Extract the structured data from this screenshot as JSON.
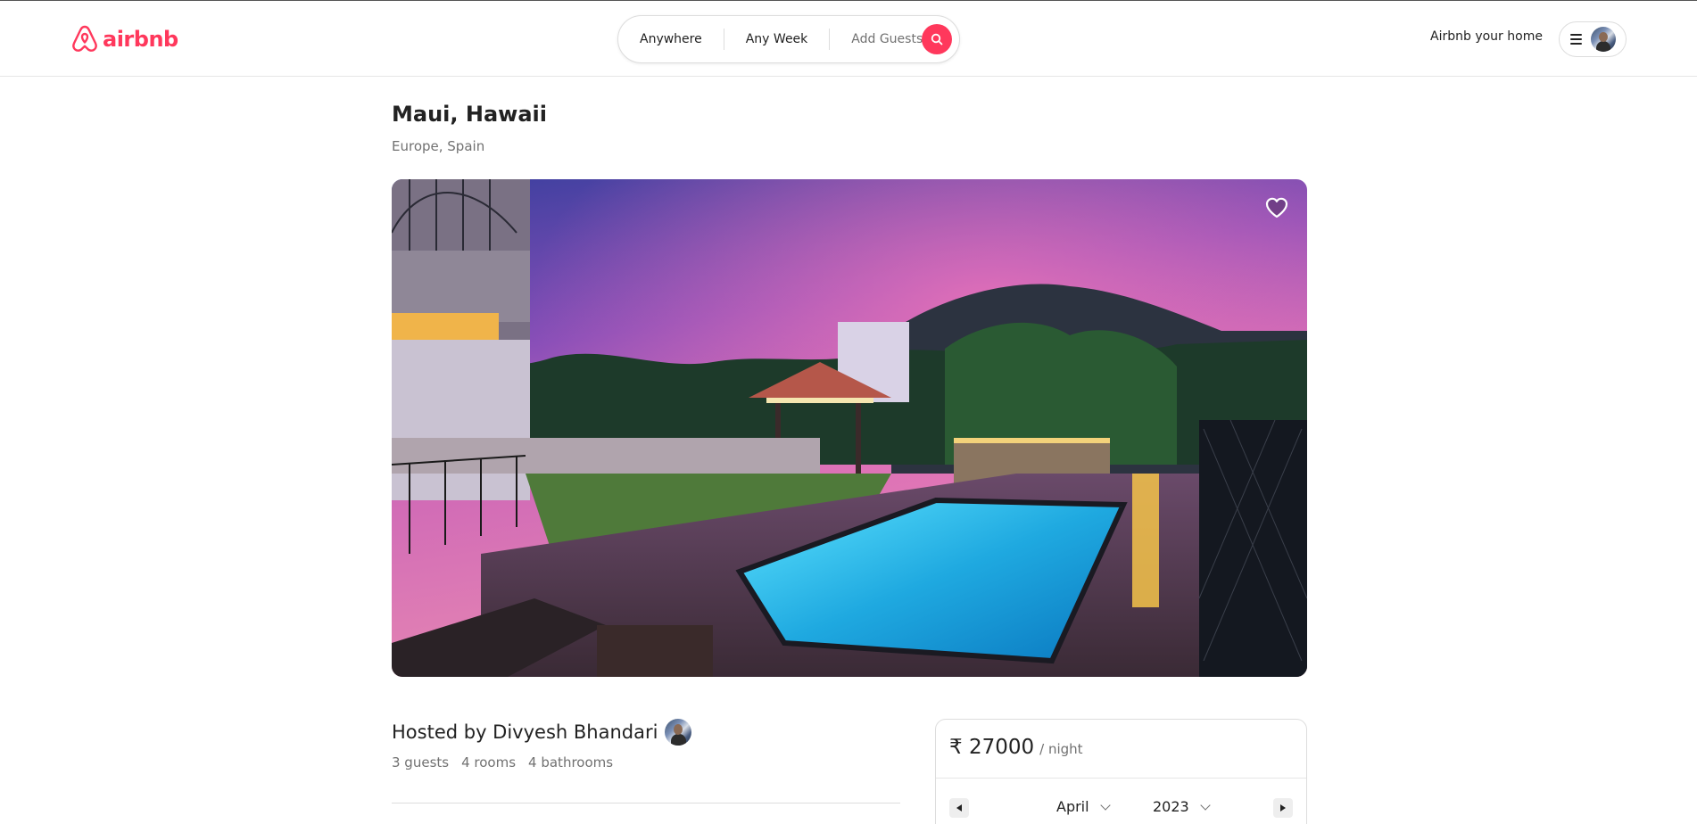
{
  "header": {
    "brand": "airbnb",
    "brand_color": "#FF385C",
    "search": {
      "where": "Anywhere",
      "when": "Any Week",
      "guests": "Add Guests"
    },
    "host_link": "Airbnb your home",
    "icons": {
      "logo": "airbnb-logo-icon",
      "search": "search-icon",
      "menu": "hamburger-menu-icon",
      "avatar": "user-avatar"
    }
  },
  "listing": {
    "title": "Maui, Hawaii",
    "location": "Europe, Spain",
    "hero_image": "villa-pool-sunset-photo",
    "favorite_icon": "heart-icon",
    "host_line": "Hosted by Divyesh Bhandari",
    "stats": [
      "3 guests",
      "4 rooms",
      "4 bathrooms"
    ]
  },
  "booking": {
    "price": "₹ 27000",
    "per_night": "/ night",
    "calendar": {
      "month": "April",
      "year": "2023",
      "prev_icon": "triangle-left-icon",
      "next_icon": "triangle-right-icon"
    }
  }
}
